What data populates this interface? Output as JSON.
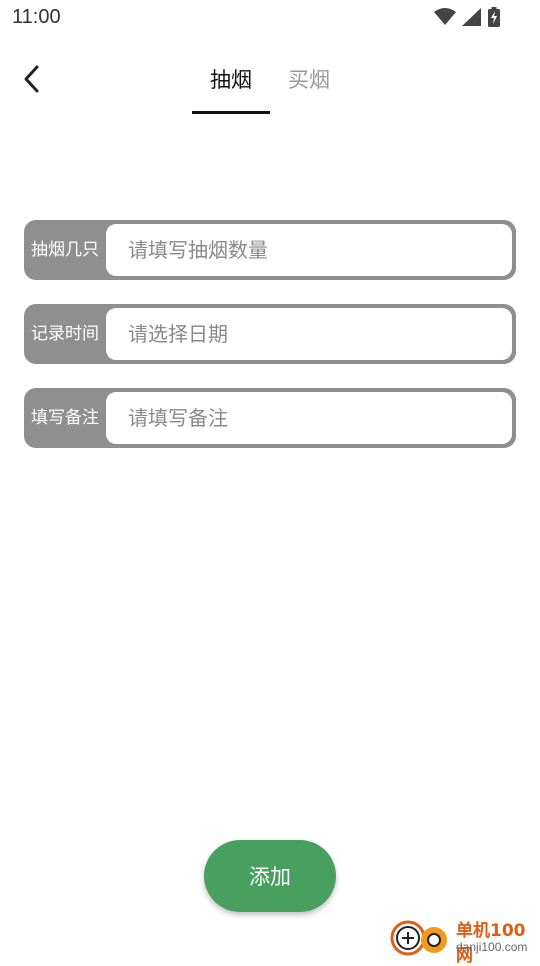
{
  "status_bar": {
    "time": "11:00",
    "icons": [
      "wifi-icon",
      "signal-icon",
      "battery-charging-icon"
    ]
  },
  "header": {
    "back_icon": "chevron-left-icon",
    "tabs": [
      {
        "label": "抽烟",
        "active": true
      },
      {
        "label": "买烟",
        "active": false
      }
    ]
  },
  "form": {
    "rows": [
      {
        "label": "抽烟几只",
        "placeholder": "请填写抽烟数量",
        "value": ""
      },
      {
        "label": "记录时间",
        "placeholder": "请选择日期",
        "value": ""
      },
      {
        "label": "填写备注",
        "placeholder": "请填写备注",
        "value": ""
      }
    ]
  },
  "add_button": {
    "label": "添加"
  },
  "watermark": {
    "title": "单机100网",
    "url": "danji100.com"
  },
  "colors": {
    "accent_green": "#48a060",
    "label_gray": "#8f8f8f",
    "tab_inactive": "#9a9a9a",
    "watermark_orange": "#e25d12"
  }
}
